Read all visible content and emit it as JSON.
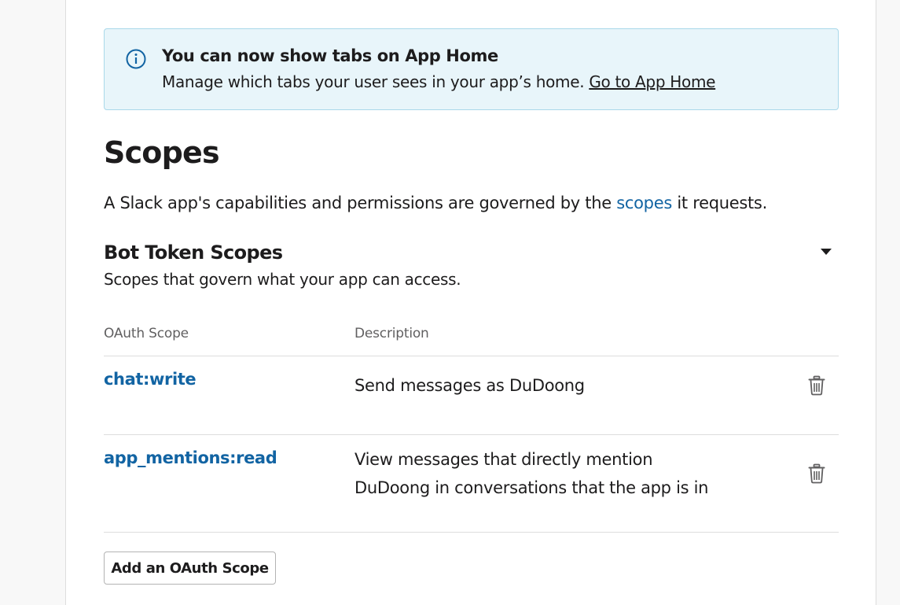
{
  "banner": {
    "title": "You can now show tabs on App Home",
    "body": "Manage which tabs your user sees in your app’s home. ",
    "link": "Go to App Home",
    "icon": "info-icon"
  },
  "page": {
    "title": "Scopes",
    "intro_before": "A Slack app's capabilities and permissions are governed by the ",
    "intro_link": "scopes",
    "intro_after": " it requests."
  },
  "bot_scopes": {
    "title": "Bot Token Scopes",
    "description": "Scopes that govern what your app can access.",
    "columns": [
      "OAuth Scope",
      "Description"
    ],
    "rows": [
      {
        "scope": "chat:write",
        "description": "Send messages as DuDoong"
      },
      {
        "scope": "app_mentions:read",
        "description": "View messages that directly mention DuDoong in conversations that the app is in"
      }
    ],
    "add_button": "Add an OAuth Scope"
  },
  "colors": {
    "link": "#1264a3",
    "banner_bg": "#e8f5fa",
    "banner_border": "#a9d8ea",
    "text": "#1d1c1d",
    "muted": "#616061"
  }
}
